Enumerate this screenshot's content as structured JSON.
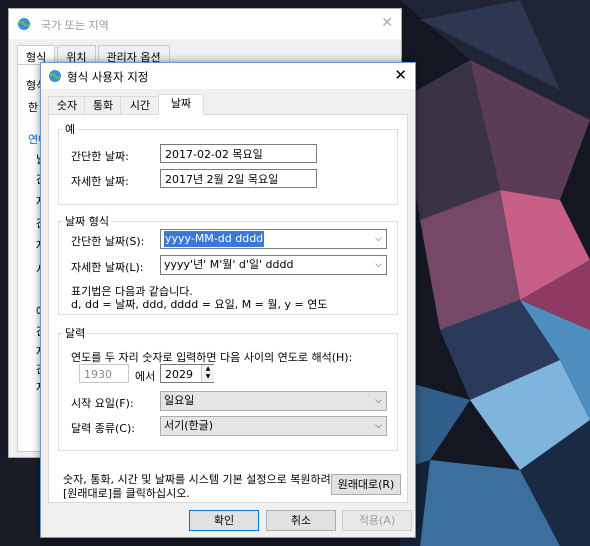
{
  "back_window": {
    "title": "국가 또는 지역",
    "tabs": [
      {
        "label": "형식"
      },
      {
        "label": "위치"
      },
      {
        "label": "관리자 옵션"
      }
    ],
    "fragments": [
      "형식",
      "한",
      "연어",
      "날",
      "간",
      "자",
      "간",
      "자",
      "시",
      "예",
      "간",
      "자",
      "간",
      "자"
    ]
  },
  "dialog": {
    "title": "형식 사용자 지정",
    "tabs": [
      {
        "label": "숫자"
      },
      {
        "label": "통화"
      },
      {
        "label": "시간"
      },
      {
        "label": "날짜"
      }
    ],
    "example_group": {
      "legend": "예",
      "short_label": "간단한 날짜:",
      "short_value": "2017-02-02 목요일",
      "long_label": "자세한 날짜:",
      "long_value": "2017년 2월 2일 목요일"
    },
    "format_group": {
      "legend": "날짜 형식",
      "short_label": "간단한 날짜(S):",
      "short_value": "yyyy-MM-dd dddd",
      "long_label": "자세한 날짜(L):",
      "long_value": "yyyy'년' M'월' d'일' dddd",
      "notation_line1": "표기법은 다음과 같습니다.",
      "notation_line2": "d, dd = 날짜,  ddd, dddd = 요일,  M = 월,  y = 연도"
    },
    "calendar_group": {
      "legend": "달력",
      "two_digit_text": "연도를 두 자리 숫자로 입력하면 다음 사이의 연도로 해석(H):",
      "from_year": "1930",
      "to_label": "에서",
      "to_year": "2029",
      "first_day_label": "시작 요일(F):",
      "first_day_value": "일요일",
      "calendar_type_label": "달력 종류(C):",
      "calendar_type_value": "서기(한글)"
    },
    "reset_text_line1": "숫자, 통화, 시간 및 날짜를 시스템 기본 설정으로 복원하려면",
    "reset_text_line2": "[원래대로]를 클릭하십시오.",
    "reset_button": "원래대로(R)",
    "ok_button": "확인",
    "cancel_button": "취소",
    "apply_button": "적용(A)"
  },
  "colors": {
    "accent": "#0078d7",
    "selection": "#3a78d8"
  },
  "icons": {
    "app": "globe-icon",
    "close": "close-icon",
    "dropdown": "chevron-down-icon",
    "spinner": "spin-arrows-icon"
  }
}
